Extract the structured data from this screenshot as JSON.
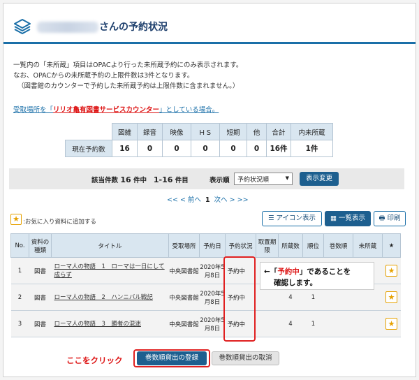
{
  "header": {
    "title": "さんの予約状況"
  },
  "notes": [
    "一覧内の「未所蔵」項目はOPACより行った未所蔵予約にのみ表示されます。",
    "なお、OPACからの未所蔵予約の上限件数は3件となります。",
    "（図書館のカウンターで予約した未所蔵予約は上限件数に含まれません。）"
  ],
  "pickup": {
    "prefix": "受取場所を「",
    "location": "リリオ亀有図書サービスカウンター",
    "suffix": "」としている場合。"
  },
  "counts": {
    "headers": [
      "図雑",
      "録音",
      "映像",
      "ＨＳ",
      "短期",
      "他",
      "合計",
      "内未所蔵"
    ],
    "row_label": "現在予約数",
    "values": [
      "16",
      "0",
      "0",
      "0",
      "0",
      "0",
      "16件",
      "1件"
    ]
  },
  "filter": {
    "count_label": "該当件数",
    "count_value": "16",
    "count_mid": "件中",
    "range": "1-16",
    "range_unit": "件目",
    "order_label": "表示順",
    "order_value": "予約状況順",
    "apply_label": "表示変更"
  },
  "pager": {
    "prev": "<< < 前へ",
    "current": "1",
    "next": "次へ > >>"
  },
  "favorites_note": ":お気に入り資料に追加する",
  "view_buttons": {
    "icon_view": "アイコン表示",
    "list_view": "一覧表示",
    "print": "印刷"
  },
  "table": {
    "headers": [
      "No.",
      "資料の種類",
      "タイトル",
      "受取場所",
      "予約日",
      "予約状況",
      "取置期限",
      "所蔵数",
      "順位",
      "巻数順",
      "未所蔵",
      "★"
    ],
    "rows": [
      {
        "no": "1",
        "type": "図書",
        "title": "ローマ人の物語　1　ローマは一日にして成らず",
        "place": "中央図書館",
        "date": "2020年5月8日",
        "status": "予約中",
        "limit": "",
        "holdings": "",
        "rank": "",
        "vol": "",
        "unheld": ""
      },
      {
        "no": "2",
        "type": "図書",
        "title": "ローマ人の物語　2　ハンニバル戦記",
        "place": "中央図書館",
        "date": "2020年5月8日",
        "status": "予約中",
        "limit": "",
        "holdings": "4",
        "rank": "1",
        "vol": "",
        "unheld": ""
      },
      {
        "no": "3",
        "type": "図書",
        "title": "ローマ人の物語　3　勝者の混迷",
        "place": "中央図書館",
        "date": "2020年5月8日",
        "status": "予約中",
        "limit": "",
        "holdings": "4",
        "rank": "1",
        "vol": "",
        "unheld": ""
      }
    ]
  },
  "callout": {
    "line1_pre": "←「",
    "line1_status": "予約中",
    "line1_post": "」であることを",
    "line2": "確認します。"
  },
  "footer": {
    "click_here": "ここをクリック",
    "register": "巻数順貸出の登録",
    "cancel": "巻数順貸出の取消"
  },
  "colors": {
    "accent": "#1a6fa8",
    "button": "#1d5f8f",
    "highlight": "#e02020",
    "star": "#e6a100"
  },
  "star_glyph": "★"
}
